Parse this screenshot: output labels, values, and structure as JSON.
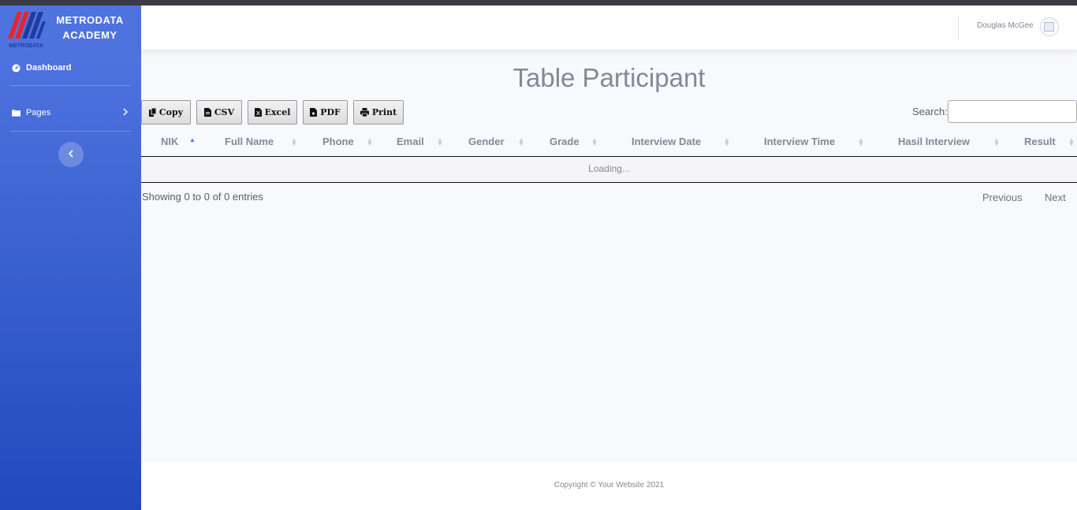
{
  "brand": {
    "logo_caption": "METRODATA",
    "line1": "METRODATA",
    "line2": "ACADEMY"
  },
  "sidebar": {
    "items": [
      {
        "label": "Dashboard",
        "icon": "tachometer-icon"
      },
      {
        "label": "Pages",
        "icon": "folder-icon"
      }
    ],
    "toggle_icon": "chevron-left-icon"
  },
  "topbar": {
    "user_name": "Douglas McGee",
    "avatar_icon": "broken-image-icon"
  },
  "page": {
    "title": "Table Participant"
  },
  "toolbar": {
    "buttons": [
      {
        "label": "Copy",
        "icon": "copy-icon"
      },
      {
        "label": "CSV",
        "icon": "file-csv-icon"
      },
      {
        "label": "Excel",
        "icon": "file-excel-icon"
      },
      {
        "label": "PDF",
        "icon": "file-pdf-icon"
      },
      {
        "label": "Print",
        "icon": "print-icon"
      }
    ],
    "search_label": "Search:",
    "search_value": ""
  },
  "table": {
    "columns": [
      "NIK",
      "Full Name",
      "Phone",
      "Email",
      "Gender",
      "Grade",
      "Interview Date",
      "Interview Time",
      "Hasil Interview",
      "Result"
    ],
    "sorted_column": "NIK",
    "sort_direction": "asc",
    "loading_text": "Loading...",
    "info": "Showing 0 to 0 of 0 entries",
    "pagination": {
      "previous": "Previous",
      "next": "Next"
    }
  },
  "footer": {
    "copyright": "Copyright © Your Website 2021"
  },
  "colors": {
    "sidebar_top": "#4e73df",
    "sidebar_bottom": "#224abe",
    "text_muted": "#858796",
    "page_bg": "#f8f9fc"
  }
}
